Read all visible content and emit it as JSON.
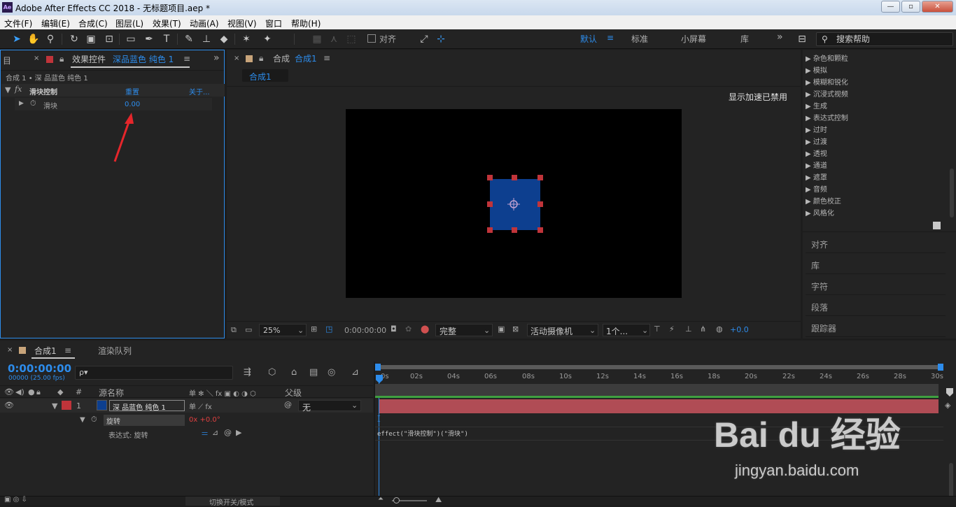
{
  "window": {
    "app_icon": "Ae",
    "title": "Adobe After Effects CC 2018 - 无标题项目.aep *",
    "min": "—",
    "max": "▫",
    "close": "✕"
  },
  "menu": [
    "文件(F)",
    "编辑(E)",
    "合成(C)",
    "图层(L)",
    "效果(T)",
    "动画(A)",
    "视图(V)",
    "窗口",
    "帮助(H)"
  ],
  "toolbar": {
    "snap_label": "对齐",
    "workspaces": [
      "默认",
      "标准",
      "小屏幕",
      "库"
    ],
    "active_workspace": "默认",
    "more": "»",
    "search_placeholder": "搜索帮助"
  },
  "effects_panel": {
    "tab_prefix": "效果控件",
    "tab_layer": "深品蓝色 纯色 1",
    "breadcrumb": "合成 1 • 深 品蓝色 纯色 1",
    "effect_name": "滑块控制",
    "reset": "重置",
    "about": "关于...",
    "param_name": "滑块",
    "param_value": "0.00"
  },
  "comp_panel": {
    "tab_label": "合成",
    "tab_name": "合成1",
    "sub_tab": "合成1",
    "notice": "显示加速已禁用",
    "zoom": "25%",
    "timecode": "0:00:00:00",
    "quality": "完整",
    "camera": "活动摄像机",
    "views": "1个...",
    "exposure": "+0.0",
    "colors": {
      "canvas": "#000000",
      "solid": "#0d3f8f",
      "handle": "#c0343a"
    }
  },
  "effects_presets": {
    "categories": [
      "杂色和颗粒",
      "模拟",
      "模糊和锐化",
      "沉浸式视频",
      "生成",
      "表达式控制",
      "过时",
      "过渡",
      "透视",
      "通道",
      "遮罩",
      "音频",
      "颜色校正",
      "风格化"
    ],
    "panels": [
      "对齐",
      "库",
      "字符",
      "段落",
      "跟踪器"
    ]
  },
  "timeline": {
    "tab_name": "合成1",
    "render_queue": "渲染队列",
    "timecode": "0:00:00:00",
    "fps": "00000 (25.00 fps)",
    "search_placeholder": "ρ▾",
    "headers": {
      "num": "#",
      "source": "源名称",
      "switches": "单 ✻ ＼ fx ▣ ◐ ◑ ⬡",
      "parent": "父级"
    },
    "layer": {
      "num": "1",
      "name": "深 品蓝色 纯色 1",
      "parent": "无"
    },
    "prop": {
      "name": "旋转",
      "value": "0x +0.0°"
    },
    "expr_label": "表达式: 旋转",
    "expression": "effect(\"滑块控制\")(\"滑块\")",
    "cursor": "I",
    "ticks": [
      "0s",
      "02s",
      "04s",
      "06s",
      "08s",
      "10s",
      "12s",
      "14s",
      "16s",
      "18s",
      "20s",
      "22s",
      "24s",
      "26s",
      "28s",
      "30s"
    ],
    "footer": "切换开关/模式"
  },
  "watermark": {
    "brand": "Bai du 经验",
    "url": "jingyan.baidu.com"
  }
}
